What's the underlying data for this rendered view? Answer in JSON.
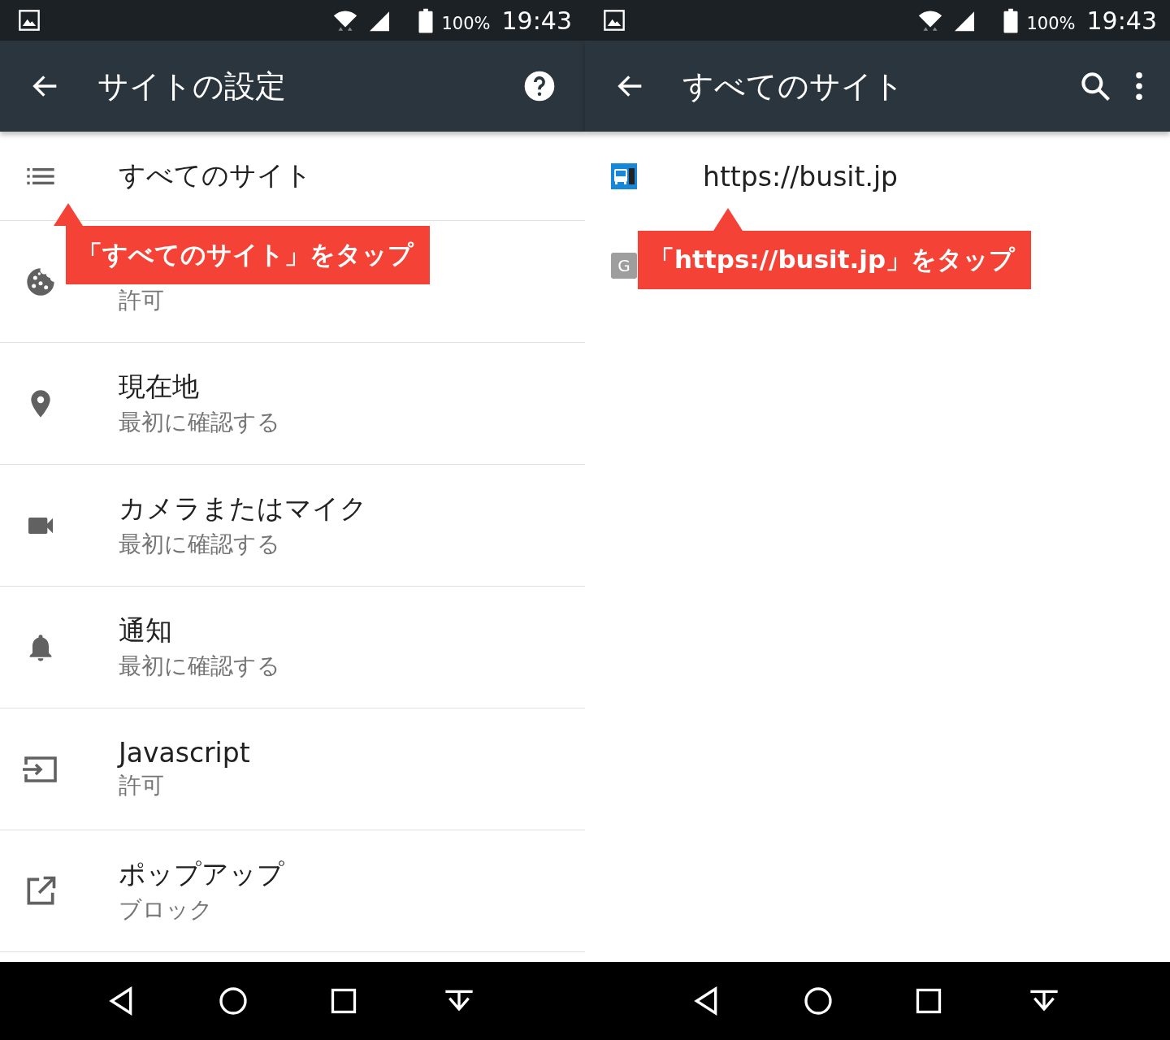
{
  "panels": [
    {
      "status": {
        "battery": "100%",
        "time": "19:43"
      },
      "toolbar": {
        "title": "サイトの設定",
        "actions": [
          {
            "kind": "help"
          }
        ]
      },
      "items": [
        {
          "kind": "list",
          "title": "すべてのサイト"
        },
        {
          "kind": "cookie",
          "subtitle": "許可"
        },
        {
          "kind": "location",
          "title": "現在地",
          "subtitle": "最初に確認する"
        },
        {
          "kind": "camera",
          "title": "カメラまたはマイク",
          "subtitle": "最初に確認する"
        },
        {
          "kind": "bell",
          "title": "通知",
          "subtitle": "最初に確認する"
        },
        {
          "kind": "script",
          "title": "Javascript",
          "subtitle": "許可"
        },
        {
          "kind": "popup",
          "title": "ポップアップ",
          "subtitle": "ブロック"
        }
      ],
      "callout": {
        "text": "「すべてのサイト」をタップ"
      }
    },
    {
      "status": {
        "battery": "100%",
        "time": "19:43"
      },
      "toolbar": {
        "title": "すべてのサイト",
        "actions": [
          {
            "kind": "search"
          },
          {
            "kind": "more"
          }
        ]
      },
      "items": [
        {
          "kind": "favicon",
          "title": "https://busit.jp"
        },
        {
          "kind": "letter",
          "letter": "G"
        }
      ],
      "callout": {
        "text": "「https://busit.jp」をタップ"
      }
    }
  ]
}
